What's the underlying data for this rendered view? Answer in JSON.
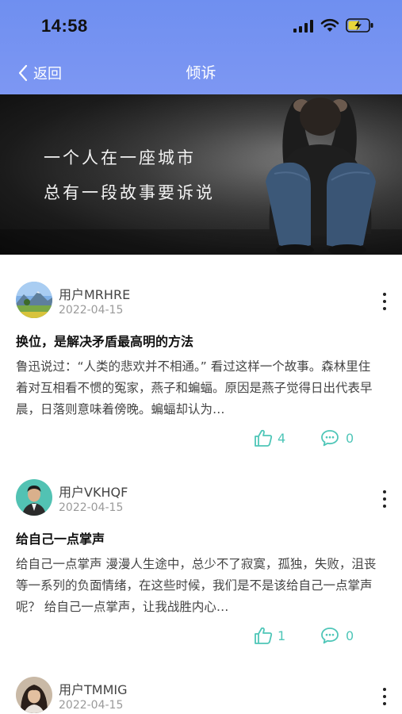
{
  "status_bar": {
    "time": "14:58"
  },
  "nav": {
    "back_label": "返回",
    "title": "倾诉"
  },
  "banner": {
    "line1": "一个人在一座城市",
    "line2": "总有一段故事要诉说"
  },
  "posts": [
    {
      "username": "用户MRHRE",
      "date": "2022-04-15",
      "title": "换位，是解决矛盾最高明的方法",
      "excerpt": "鲁迅说过：“人类的悲欢并不相通。” 看过这样一个故事。森林里住着对互相看不惯的冤家，燕子和蝙蝠。原因是燕子觉得日出代表早晨，日落则意味着傍晚。蝙蝠却认为…",
      "likes": "4",
      "comments": "0"
    },
    {
      "username": "用户VKHQF",
      "date": "2022-04-15",
      "title": "给自己一点掌声",
      "excerpt": "给自己一点掌声 漫漫人生途中，总少不了寂寞，孤独，失败，沮丧等一系列的负面情绪，在这些时候，我们是不是该给自己一点掌声呢？ 给自己一点掌声，让我战胜内心…",
      "likes": "1",
      "comments": "0"
    },
    {
      "username": "用户TMMIG",
      "date": "2022-04-15"
    }
  ],
  "colors": {
    "header": "#7590f1",
    "accent": "#4fc6b8"
  },
  "icons": {
    "back": "chevron-left-icon",
    "like": "thumbs-up-icon",
    "comment": "chat-bubble-icon",
    "more": "more-vertical-icon"
  }
}
